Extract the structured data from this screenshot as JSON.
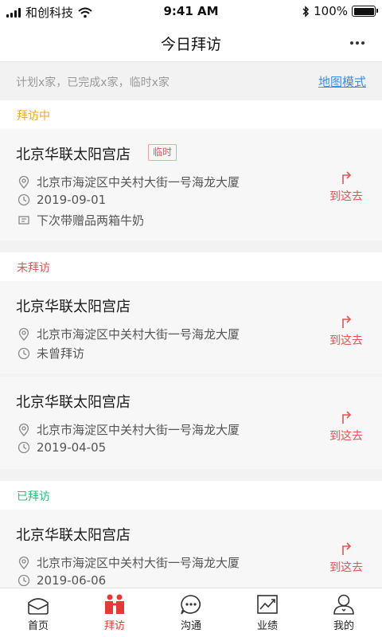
{
  "status_bar": {
    "carrier": "和创科技",
    "time": "9:41 AM",
    "battery": "100%"
  },
  "header": {
    "title": "今日拜访"
  },
  "summary": {
    "text": "计划x家，已完成x家，临时x家",
    "map_link": "地图模式"
  },
  "sections": [
    {
      "title": "拜访中",
      "color": "#f5a623",
      "cards": [
        {
          "store": "北京华联太阳宫店",
          "badge": "临时",
          "address": "北京市海淀区中关村大街一号海龙大厦",
          "date": "2019-09-01",
          "note": "下次带赠品两箱牛奶",
          "action": "到这去"
        }
      ]
    },
    {
      "title": "未拜访",
      "color": "#e05555",
      "cards": [
        {
          "store": "北京华联太阳宫店",
          "address": "北京市海淀区中关村大街一号海龙大厦",
          "date": "未曾拜访",
          "action": "到这去"
        },
        {
          "store": "北京华联太阳宫店",
          "address": "北京市海淀区中关村大街一号海龙大厦",
          "date": "2019-04-05",
          "action": "到这去"
        }
      ]
    },
    {
      "title": "已拜访",
      "color": "#2ebd7a",
      "cards": [
        {
          "store": "北京华联太阳宫店",
          "address": "北京市海淀区中关村大街一号海龙大厦",
          "date": "2019-06-06",
          "action": "到这去"
        }
      ]
    }
  ],
  "tabbar": {
    "items": [
      {
        "label": "首页",
        "icon": "home-icon"
      },
      {
        "label": "拜访",
        "icon": "visit-icon",
        "active": true
      },
      {
        "label": "沟通",
        "icon": "chat-icon"
      },
      {
        "label": "业绩",
        "icon": "performance-icon"
      },
      {
        "label": "我的",
        "icon": "profile-icon"
      }
    ]
  },
  "colors": {
    "accent": "#e53935",
    "link": "#3b8de3"
  }
}
